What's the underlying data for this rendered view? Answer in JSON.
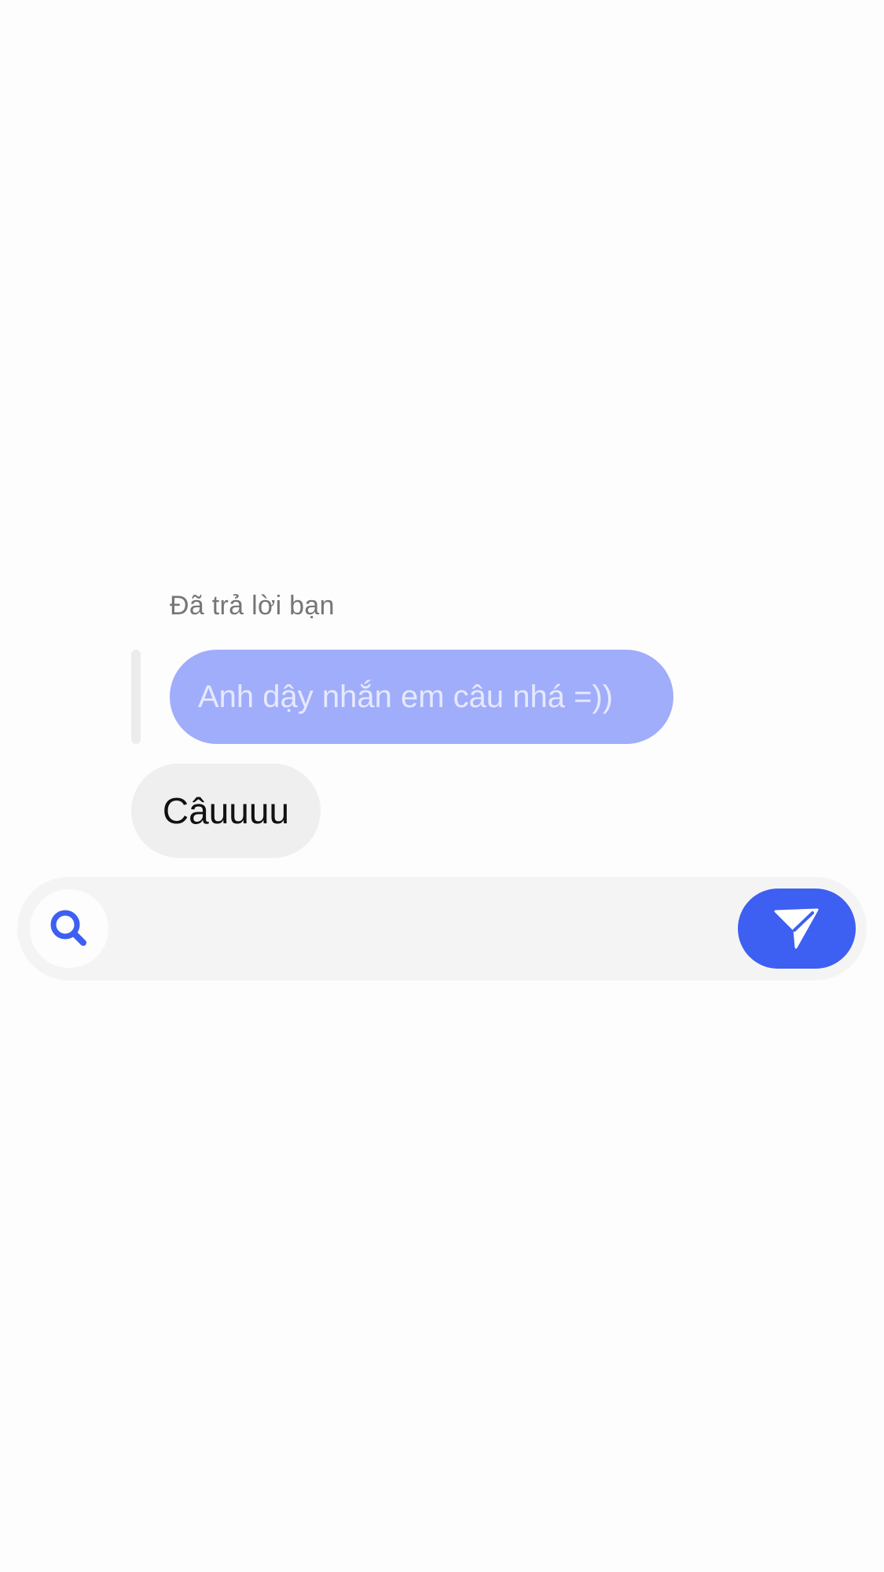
{
  "reply": {
    "caption": "Đã trả lời bạn",
    "quoted_message": "Anh dậy nhắn em câu nhá =))"
  },
  "message": {
    "text": "Câuuuu"
  },
  "composer": {
    "input_value": "",
    "search_icon": "search-icon",
    "send_icon": "send-icon"
  },
  "colors": {
    "accent": "#3d5ff2",
    "quoted_bubble": "#a0adfb",
    "message_bubble": "#efefef",
    "composer_bg": "#f4f4f4"
  }
}
